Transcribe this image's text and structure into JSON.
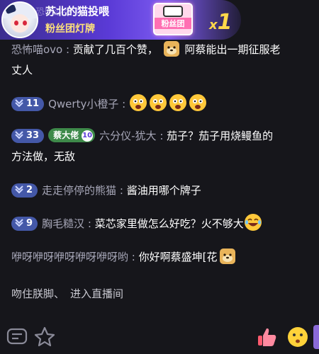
{
  "gift_banner": {
    "behind_text": "恐吃沙委了",
    "title": "苏北的猫投喂",
    "subtitle": "粉丝团灯牌",
    "gift_label": "粉丝团",
    "count_prefix": "x",
    "count": "1"
  },
  "messages": [
    {
      "user": "恐怖喵ovo",
      "sep": ":",
      "text": "贡献了几百个赞，",
      "text2": "阿蔡能出一期征服老",
      "text3": "丈人"
    },
    {
      "badge_level": "11",
      "user": "Qwerty小橙子",
      "sep": ":"
    },
    {
      "badge_level": "33",
      "fan_name": "蔡大佬",
      "fan_level": "10",
      "user": "六分仪-犹大",
      "sep": ":",
      "text": "茄子？茄子用烧鳗鱼的",
      "text2": "方法做，无敌"
    },
    {
      "badge_level": "2",
      "user": "走走停停的熊猫",
      "sep": ":",
      "text": "酱油用哪个牌子"
    },
    {
      "badge_level": "9",
      "user": "胸毛糙汉",
      "sep": ":",
      "text": "菜芯家里做怎么好吃？火不够大"
    },
    {
      "user": "咿呀咿呀咿呀咿呀咿呀哟",
      "sep": ":",
      "text": "你好啊蔡盛坤[花"
    }
  ],
  "enter_notice": {
    "user": "吻住朕脚、",
    "text": "进入直播间"
  },
  "colors": {
    "badge": "#4458a8",
    "fan_badge": "#3e8a4a",
    "background": "#16161b",
    "gift_count": "#ffd84a"
  },
  "bottom_icons": [
    "comment-icon",
    "star-icon",
    "thumbs-up-icon",
    "emoji-face-icon"
  ]
}
